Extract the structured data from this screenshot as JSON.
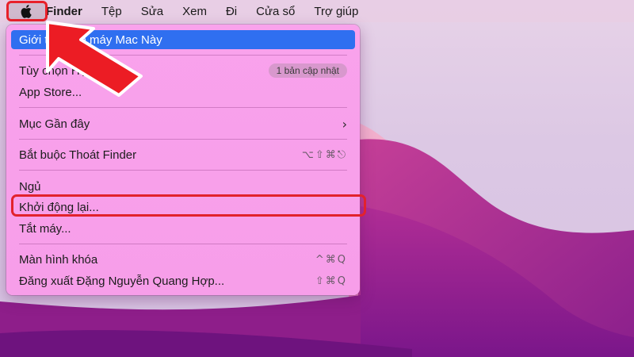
{
  "menubar": {
    "apple_icon": "apple-logo-icon",
    "items": [
      "Finder",
      "Tệp",
      "Sửa",
      "Xem",
      "Đi",
      "Cửa sổ",
      "Trợ giúp"
    ]
  },
  "apple_menu": {
    "about": "Giới thiệu về máy Mac Này",
    "system_prefs": "Tùy chọn Hệ thống...",
    "update_badge": "1 bản cập nhật",
    "app_store": "App Store...",
    "recent_items": "Mục Gần đây",
    "force_quit": "Bắt buộc Thoát Finder",
    "force_quit_shortcut": "⌥⇧⌘⎋",
    "sleep": "Ngủ",
    "restart": "Khởi động lại...",
    "shutdown": "Tắt máy...",
    "lock_screen": "Màn hình khóa",
    "lock_screen_shortcut": "^⌘Q",
    "logout": "Đăng xuất Đặng Nguyễn Quang Hợp...",
    "logout_shortcut": "⇧⌘Q"
  },
  "colors": {
    "highlight": "#2f6ff0",
    "annotation_red": "#e2222c",
    "menu_bg": "#f8a0eb"
  }
}
